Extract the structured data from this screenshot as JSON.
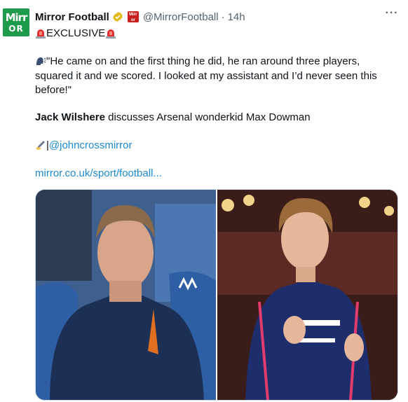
{
  "tweet": {
    "avatar_top": "Mirr",
    "avatar_bottom": "OR",
    "display_name": "Mirror Football",
    "handle": "@MirrorFootball",
    "separator": "·",
    "time": "14h",
    "more_label": "···",
    "exclusive_label": "EXCLUSIVE",
    "quote": "\"He came on and the first thing he did, he ran around three players,",
    "quote_line2": "squared it and we scored. I looked at my assistant and I’d never seen this",
    "quote_line3": "before!\"",
    "subject_bold": "Jack Wilshere",
    "subject_rest": " discusses Arsenal wonderkid Max Dowman",
    "credit_prefix": "|",
    "credit_handle": "@johncrossmirror",
    "url": "mirror.co.uk/sport/football..."
  },
  "icons": {
    "verified": "verified-gold-badge-icon",
    "affiliate": "mirror-affiliate-badge-icon",
    "siren": "rotating-light-icon",
    "speaking": "speaking-head-icon",
    "writing": "writing-hand-icon",
    "more": "more-options-icon"
  },
  "colors": {
    "link": "#1d8bd1",
    "brand_green": "#1d9a4a",
    "verified_gold": "#e2b719",
    "muted": "#536471"
  }
}
